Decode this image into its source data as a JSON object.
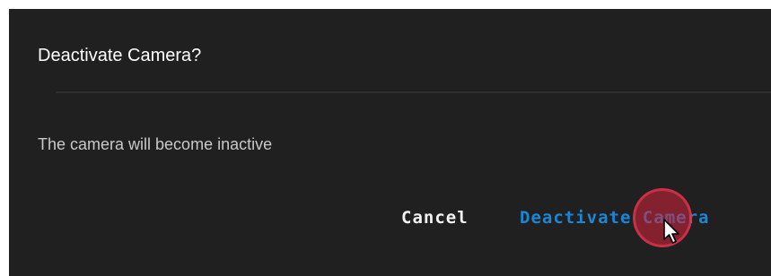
{
  "dialog": {
    "title": "Deactivate Camera?",
    "message": "The camera will become inactive",
    "cancel_label": "Cancel",
    "confirm_label": "Deactivate Camera"
  },
  "colors": {
    "background": "#202020",
    "title_text": "#ffffff",
    "body_text": "#c9c9c9",
    "accent": "#1a86d6",
    "click_indicator": "#d6223c"
  },
  "icons": {
    "cursor": "mouse-pointer-icon",
    "click": "click-indicator"
  }
}
